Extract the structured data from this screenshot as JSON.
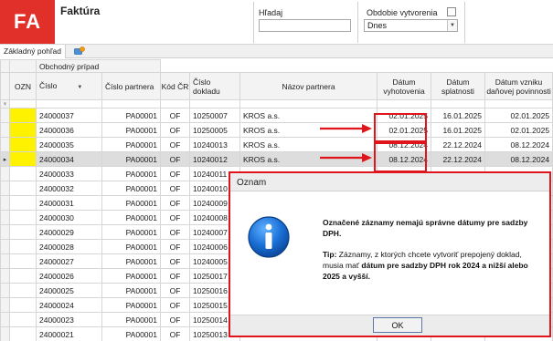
{
  "header": {
    "logo": "FA",
    "title": "Faktúra",
    "search_label": "Hľadaj",
    "search_value": "",
    "period_label": "Obdobie vytvorenia",
    "period_value": "Dnes"
  },
  "tabs": {
    "main_label": "Základný pohľad"
  },
  "grid": {
    "group_header": "Obchodný prípad",
    "columns": {
      "ozn": "OZN",
      "cislo": "Číslo",
      "cislo_partnera": "Číslo partnera",
      "kod_cr": "Kód ČR",
      "cislo_dokladu": "Číslo dokladu",
      "nazov_partnera": "Názov partnera",
      "datum_vyhotovenia": "Dátum vyhotovenia",
      "datum_splatnosti": "Dátum splatnosti",
      "datum_dph": "Dátum vzniku daňovej povinnosti"
    },
    "filter_marker": "♀",
    "current_row_marker": "▸",
    "rows": [
      {
        "cislo": "24000037",
        "partner": "PA00001",
        "kod": "OF",
        "doklad": "10250007",
        "nazov": "KROS a.s.",
        "vyhotovenie": "02.01.2025",
        "splatnost": "16.01.2025",
        "dph": "02.01.2025"
      },
      {
        "cislo": "24000036",
        "partner": "PA00001",
        "kod": "OF",
        "doklad": "10250005",
        "nazov": "KROS a.s.",
        "vyhotovenie": "02.01.2025",
        "splatnost": "16.01.2025",
        "dph": "02.01.2025"
      },
      {
        "cislo": "24000035",
        "partner": "PA00001",
        "kod": "OF",
        "doklad": "10240013",
        "nazov": "KROS a.s.",
        "vyhotovenie": "08.12.2024",
        "splatnost": "22.12.2024",
        "dph": "08.12.2024"
      },
      {
        "cislo": "24000034",
        "partner": "PA00001",
        "kod": "OF",
        "doklad": "10240012",
        "nazov": "KROS a.s.",
        "vyhotovenie": "08.12.2024",
        "splatnost": "22.12.2024",
        "dph": "08.12.2024"
      },
      {
        "cislo": "24000033",
        "partner": "PA00001",
        "kod": "OF",
        "doklad": "10240011"
      },
      {
        "cislo": "24000032",
        "partner": "PA00001",
        "kod": "OF",
        "doklad": "10240010"
      },
      {
        "cislo": "24000031",
        "partner": "PA00001",
        "kod": "OF",
        "doklad": "10240009"
      },
      {
        "cislo": "24000030",
        "partner": "PA00001",
        "kod": "OF",
        "doklad": "10240008"
      },
      {
        "cislo": "24000029",
        "partner": "PA00001",
        "kod": "OF",
        "doklad": "10240007"
      },
      {
        "cislo": "24000028",
        "partner": "PA00001",
        "kod": "OF",
        "doklad": "10240006"
      },
      {
        "cislo": "24000027",
        "partner": "PA00001",
        "kod": "OF",
        "doklad": "10240005"
      },
      {
        "cislo": "24000026",
        "partner": "PA00001",
        "kod": "OF",
        "doklad": "10250017"
      },
      {
        "cislo": "24000025",
        "partner": "PA00001",
        "kod": "OF",
        "doklad": "10250016"
      },
      {
        "cislo": "24000024",
        "partner": "PA00001",
        "kod": "OF",
        "doklad": "10250015"
      },
      {
        "cislo": "24000023",
        "partner": "PA00001",
        "kod": "OF",
        "doklad": "10250014"
      },
      {
        "cislo": "24000021",
        "partner": "PA00001",
        "kod": "OF",
        "doklad": "10250013"
      }
    ]
  },
  "dialog": {
    "title": "Oznam",
    "message_bold": "Označené záznamy nemajú správne dátumy pre sadzby DPH.",
    "tip_label": "Tip:",
    "tip_text": " Záznamy, z ktorých chcete vytvoriť prepojený doklad, musia mať ",
    "tip_bold": "dátum pre sadzby DPH rok 2024 a nižší alebo 2025 a vyšší.",
    "ok_label": "OK"
  },
  "colors": {
    "brand_red": "#e1302a",
    "highlight_red": "#e0151b",
    "marked_yellow": "#fff200",
    "info_blue": "#1a6fd6"
  }
}
